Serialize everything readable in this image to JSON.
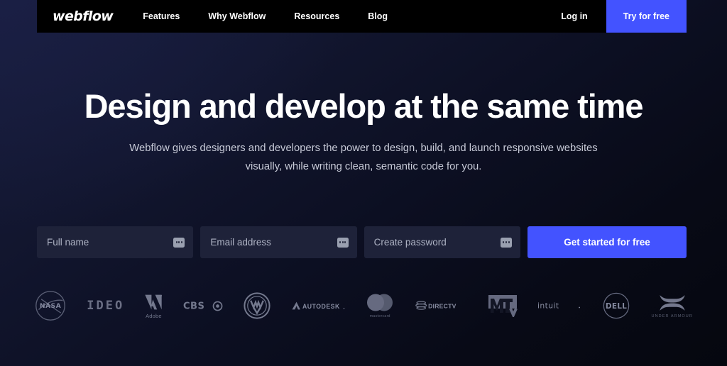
{
  "navbar": {
    "brand": "webflow",
    "links": [
      {
        "label": "Features"
      },
      {
        "label": "Why Webflow"
      },
      {
        "label": "Resources"
      },
      {
        "label": "Blog"
      }
    ],
    "login_label": "Log in",
    "cta_label": "Try for free",
    "background_color": "#000000",
    "cta_color": "#4353ff"
  },
  "hero": {
    "title": "Design and develop at the same time",
    "subtitle": "Webflow gives designers and developers the power to design, build, and launch responsive websites visually, while writing clean, semantic code for you."
  },
  "signup_form": {
    "fields": [
      {
        "placeholder": "Full name",
        "value": "",
        "autofill_icon": "three-dots-icon"
      },
      {
        "placeholder": "Email address",
        "value": "",
        "autofill_icon": "three-dots-icon"
      },
      {
        "placeholder": "Create password",
        "value": "",
        "autofill_icon": "three-dots-icon"
      }
    ],
    "submit_label": "Get started for free",
    "submit_color": "#4353ff",
    "field_background": "#1e2239"
  },
  "customer_logos": [
    {
      "name": "NASA",
      "icon": "nasa-logo"
    },
    {
      "name": "IDEO",
      "icon": "ideo-logo"
    },
    {
      "name": "Adobe",
      "icon": "adobe-logo"
    },
    {
      "name": "CBS",
      "icon": "cbs-logo"
    },
    {
      "name": "Volkswagen",
      "icon": "volkswagen-logo"
    },
    {
      "name": "AUTODESK",
      "icon": "autodesk-logo"
    },
    {
      "name": "mastercard",
      "icon": "mastercard-logo"
    },
    {
      "name": "DIRECTV",
      "icon": "directv-logo"
    },
    {
      "name": "MTV",
      "icon": "mtv-logo"
    },
    {
      "name": "intuit",
      "icon": "intuit-logo"
    },
    {
      "name": "Dell",
      "icon": "dell-logo"
    },
    {
      "name": "UNDER ARMOUR",
      "icon": "under-armour-logo"
    }
  ],
  "theme": {
    "background_top": "#161b38",
    "background_bottom": "#05070f",
    "accent": "#4353ff",
    "text_primary": "#ffffff",
    "text_secondary": "#c8cbd8"
  }
}
